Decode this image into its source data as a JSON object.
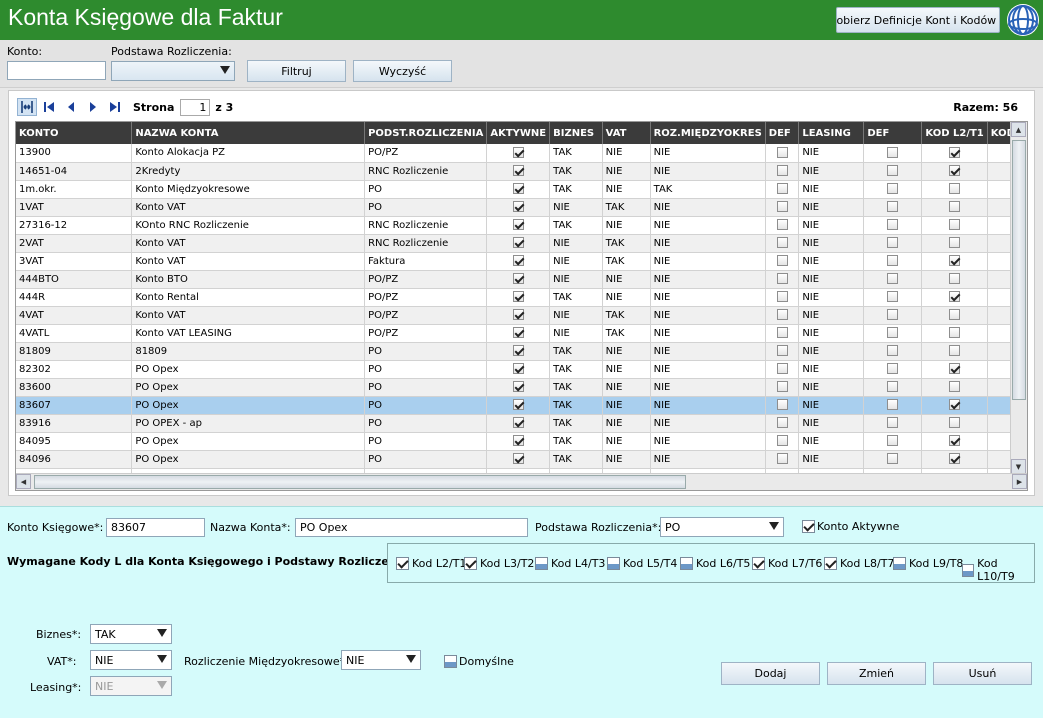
{
  "header": {
    "title": "Konta Księgowe dla Faktur",
    "definitions_button": "Pobierz Definicje Kont i Kodów L"
  },
  "filter": {
    "konto_label": "Konto:",
    "konto_value": "",
    "podstawa_label": "Podstawa Rozliczenia:",
    "podstawa_value": "",
    "filter_button": "Filtruj",
    "clear_button": "Wyczyść"
  },
  "pager": {
    "page_label": "Strona",
    "page_value": "1",
    "of_label": "z 3",
    "total_label": "Razem: 56"
  },
  "columns": [
    "KONTO",
    "NAZWA KONTA",
    "PODST.ROZLICZENIA",
    "AKTYWNE",
    "BIZNES",
    "VAT",
    "ROZ.MIĘDZYOKRES",
    "DEF",
    "LEASING",
    "DEF",
    "KOD L2/T1",
    "KOD"
  ],
  "rows": [
    {
      "konto": "13900",
      "nazwa": "Konto Alokacja PZ",
      "podst": "PO/PZ",
      "aktywne": true,
      "biznes": "TAK",
      "vat": "NIE",
      "roz": "NIE",
      "def1": false,
      "leasing": "NIE",
      "def2": false,
      "kod": true
    },
    {
      "konto": "14651-04",
      "nazwa": "2Kredyty",
      "podst": "RNC Rozliczenie",
      "aktywne": true,
      "biznes": "TAK",
      "vat": "NIE",
      "roz": "NIE",
      "def1": false,
      "leasing": "NIE",
      "def2": false,
      "kod": true
    },
    {
      "konto": "1m.okr.",
      "nazwa": "Konto Międzyokresowe",
      "podst": "PO",
      "aktywne": true,
      "biznes": "TAK",
      "vat": "NIE",
      "roz": "TAK",
      "def1": false,
      "leasing": "NIE",
      "def2": false,
      "kod": false
    },
    {
      "konto": "1VAT",
      "nazwa": "Konto VAT",
      "podst": "PO",
      "aktywne": true,
      "biznes": "NIE",
      "vat": "TAK",
      "roz": "NIE",
      "def1": false,
      "leasing": "NIE",
      "def2": false,
      "kod": false
    },
    {
      "konto": "27316-12",
      "nazwa": "KOnto RNC Rozliczenie",
      "podst": "RNC Rozliczenie",
      "aktywne": true,
      "biznes": "TAK",
      "vat": "NIE",
      "roz": "NIE",
      "def1": false,
      "leasing": "NIE",
      "def2": false,
      "kod": false
    },
    {
      "konto": "2VAT",
      "nazwa": "Konto VAT",
      "podst": "RNC Rozliczenie",
      "aktywne": true,
      "biznes": "NIE",
      "vat": "TAK",
      "roz": "NIE",
      "def1": false,
      "leasing": "NIE",
      "def2": false,
      "kod": false
    },
    {
      "konto": "3VAT",
      "nazwa": "Konto VAT",
      "podst": "Faktura",
      "aktywne": true,
      "biznes": "NIE",
      "vat": "TAK",
      "roz": "NIE",
      "def1": false,
      "leasing": "NIE",
      "def2": false,
      "kod": true
    },
    {
      "konto": "444BTO",
      "nazwa": "Konto BTO",
      "podst": "PO/PZ",
      "aktywne": true,
      "biznes": "NIE",
      "vat": "NIE",
      "roz": "NIE",
      "def1": false,
      "leasing": "NIE",
      "def2": false,
      "kod": false
    },
    {
      "konto": "444R",
      "nazwa": "Konto Rental",
      "podst": "PO/PZ",
      "aktywne": true,
      "biznes": "TAK",
      "vat": "NIE",
      "roz": "NIE",
      "def1": false,
      "leasing": "NIE",
      "def2": false,
      "kod": true
    },
    {
      "konto": "4VAT",
      "nazwa": "Konto VAT",
      "podst": "PO/PZ",
      "aktywne": true,
      "biznes": "NIE",
      "vat": "TAK",
      "roz": "NIE",
      "def1": false,
      "leasing": "NIE",
      "def2": false,
      "kod": false
    },
    {
      "konto": "4VATL",
      "nazwa": "Konto VAT LEASING",
      "podst": "PO/PZ",
      "aktywne": true,
      "biznes": "NIE",
      "vat": "TAK",
      "roz": "NIE",
      "def1": false,
      "leasing": "NIE",
      "def2": false,
      "kod": false
    },
    {
      "konto": "81809",
      "nazwa": "81809",
      "podst": "PO",
      "aktywne": true,
      "biznes": "TAK",
      "vat": "NIE",
      "roz": "NIE",
      "def1": false,
      "leasing": "NIE",
      "def2": false,
      "kod": false
    },
    {
      "konto": "82302",
      "nazwa": "PO Opex",
      "podst": "PO",
      "aktywne": true,
      "biznes": "TAK",
      "vat": "NIE",
      "roz": "NIE",
      "def1": false,
      "leasing": "NIE",
      "def2": false,
      "kod": true
    },
    {
      "konto": "83600",
      "nazwa": "PO Opex",
      "podst": "PO",
      "aktywne": true,
      "biznes": "TAK",
      "vat": "NIE",
      "roz": "NIE",
      "def1": false,
      "leasing": "NIE",
      "def2": false,
      "kod": false
    },
    {
      "konto": "83607",
      "nazwa": "PO Opex",
      "podst": "PO",
      "aktywne": true,
      "biznes": "TAK",
      "vat": "NIE",
      "roz": "NIE",
      "def1": false,
      "leasing": "NIE",
      "def2": false,
      "kod": true
    },
    {
      "konto": "83916",
      "nazwa": "PO OPEX - ap",
      "podst": "PO",
      "aktywne": true,
      "biznes": "TAK",
      "vat": "NIE",
      "roz": "NIE",
      "def1": false,
      "leasing": "NIE",
      "def2": false,
      "kod": false
    },
    {
      "konto": "84095",
      "nazwa": "PO Opex",
      "podst": "PO",
      "aktywne": true,
      "biznes": "TAK",
      "vat": "NIE",
      "roz": "NIE",
      "def1": false,
      "leasing": "NIE",
      "def2": false,
      "kod": true
    },
    {
      "konto": "84096",
      "nazwa": "PO Opex",
      "podst": "PO",
      "aktywne": true,
      "biznes": "TAK",
      "vat": "NIE",
      "roz": "NIE",
      "def1": false,
      "leasing": "NIE",
      "def2": false,
      "kod": true
    },
    {
      "konto": "",
      "nazwa": "",
      "podst": "",
      "aktywne": false,
      "biznes": "",
      "vat": "",
      "roz": "",
      "def1": false,
      "leasing": "",
      "def2": false,
      "kod": false
    }
  ],
  "selected_row": "83607",
  "detail": {
    "konto_label": "Konto Księgowe*:",
    "konto_value": "83607",
    "nazwa_label": "Nazwa Konta*:",
    "nazwa_value": "PO Opex",
    "podstawa_label": "Podstawa Rozliczenia*:",
    "podstawa_value": "PO",
    "aktywne_label": "Konto Aktywne",
    "aktywne_checked": true,
    "codes_label": "Wymagane Kody L dla Konta Księgowego i Podstawy Rozliczenia ->",
    "codes": [
      {
        "label": "Kod L2/T1",
        "checked": true
      },
      {
        "label": "Kod L3/T2",
        "checked": true
      },
      {
        "label": "Kod L4/T3",
        "checked": false
      },
      {
        "label": "Kod L5/T4",
        "checked": false
      },
      {
        "label": "Kod L6/T5",
        "checked": false
      },
      {
        "label": "Kod L7/T6",
        "checked": true
      },
      {
        "label": "Kod L8/T7",
        "checked": true
      },
      {
        "label": "Kod L9/T8",
        "checked": false
      },
      {
        "label": "Kod L10/T9",
        "checked": false
      }
    ],
    "biznes_label": "Biznes*:",
    "biznes_value": "TAK",
    "vat_label": "VAT*:",
    "vat_value": "NIE",
    "roz_label": "Rozliczenie Międzyokresowe*:",
    "roz_value": "NIE",
    "domyslne_label": "Domyślne",
    "domyslne_checked": false,
    "leasing_label": "Leasing*:",
    "leasing_value": "NIE",
    "add_button": "Dodaj",
    "change_button": "Zmień",
    "delete_button": "Usuń"
  }
}
